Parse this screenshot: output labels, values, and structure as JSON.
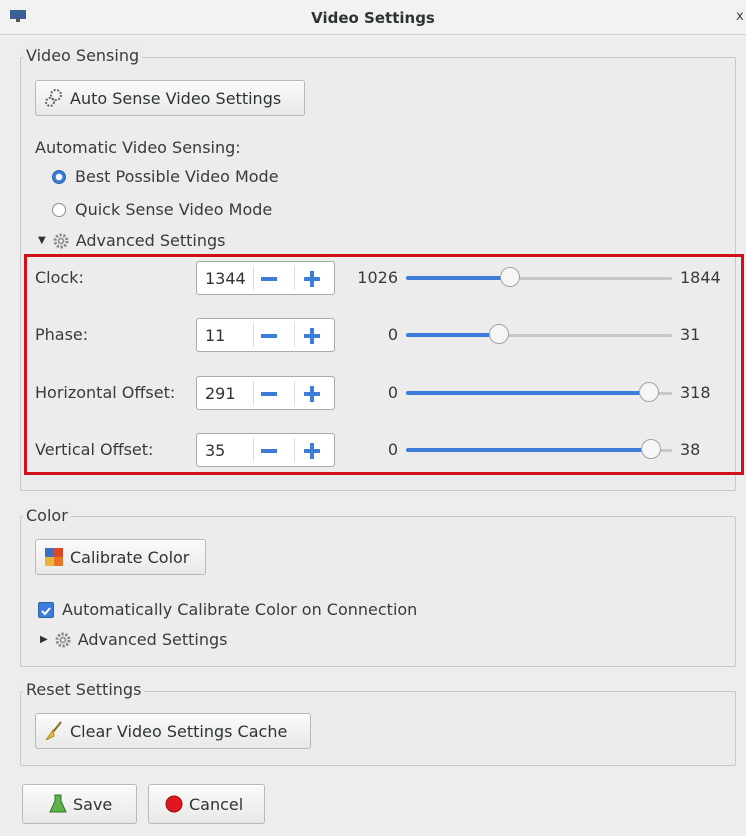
{
  "window": {
    "title": "Video Settings",
    "close_glyph": "x"
  },
  "video_sensing": {
    "label": "Video Sensing",
    "auto_sense_button": "Auto Sense Video Settings",
    "mode_label": "Automatic Video Sensing:",
    "modes": [
      {
        "label": "Best Possible Video Mode",
        "selected": true
      },
      {
        "label": "Quick Sense Video Mode",
        "selected": false
      }
    ],
    "advanced_label": "Advanced Settings",
    "settings": [
      {
        "label": "Clock:",
        "value": "1344",
        "min": "1026",
        "max": "1844",
        "fraction": 0.39
      },
      {
        "label": "Phase:",
        "value": "11",
        "min": "0",
        "max": "31",
        "fraction": 0.35
      },
      {
        "label": "Horizontal Offset:",
        "value": "291",
        "min": "0",
        "max": "318",
        "fraction": 0.915
      },
      {
        "label": "Vertical Offset:",
        "value": "35",
        "min": "0",
        "max": "38",
        "fraction": 0.92
      }
    ]
  },
  "color": {
    "label": "Color",
    "calibrate_button": "Calibrate Color",
    "auto_calibrate_label": "Automatically Calibrate Color on Connection",
    "auto_calibrate_checked": true,
    "advanced_label": "Advanced Settings"
  },
  "reset": {
    "label": "Reset Settings",
    "clear_button": "Clear Video Settings Cache"
  },
  "footer": {
    "save": "Save",
    "cancel": "Cancel"
  },
  "colors": {
    "accent": "#3b7dd8",
    "highlight": "#d0101a"
  },
  "icons": [
    "monitor-icon",
    "gears-icon",
    "gear-icon",
    "palette-icon",
    "broom-icon",
    "save-flask-icon",
    "cancel-dot-icon"
  ]
}
